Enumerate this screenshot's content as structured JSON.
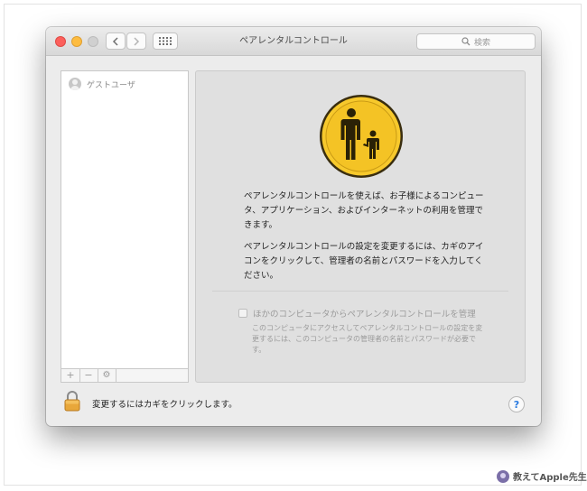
{
  "window": {
    "title": "ペアレンタルコントロール",
    "search_placeholder": "検索"
  },
  "sidebar": {
    "users": [
      {
        "name": "ゲストユーザ"
      }
    ],
    "toolbar": {
      "add": "+",
      "remove": "−",
      "settings": "⚙"
    }
  },
  "content": {
    "description1": "ペアレンタルコントロールを使えば、お子様によるコンピュータ、アプリケーション、およびインターネットの利用を管理できます。",
    "description2": "ペアレンタルコントロールの設定を変更するには、カギのアイコンをクリックして、管理者の名前とパスワードを入力してください。",
    "remote_checkbox_label": "ほかのコンピュータからペアレンタルコントロールを管理",
    "remote_checkbox_checked": false,
    "remote_description": "このコンピュータにアクセスしてペアレンタルコントロールの設定を変更するには、このコンピュータの管理者の名前とパスワードが必要です。"
  },
  "footer": {
    "lock_text": "変更するにはカギをクリックします。",
    "help_label": "?"
  },
  "watermark": {
    "text": "教えてApple先生"
  },
  "colors": {
    "close": "#fc605c",
    "minimize": "#fdbc40",
    "icon_yellow": "#f7c92c",
    "help_blue": "#2a7be0"
  },
  "icons": [
    "close-icon",
    "minimize-icon",
    "zoom-icon",
    "chevron-left-icon",
    "chevron-right-icon",
    "grid-icon",
    "search-icon",
    "user-avatar-icon",
    "plus-icon",
    "minus-icon",
    "gear-icon",
    "parental-controls-icon",
    "lock-icon",
    "help-icon"
  ]
}
